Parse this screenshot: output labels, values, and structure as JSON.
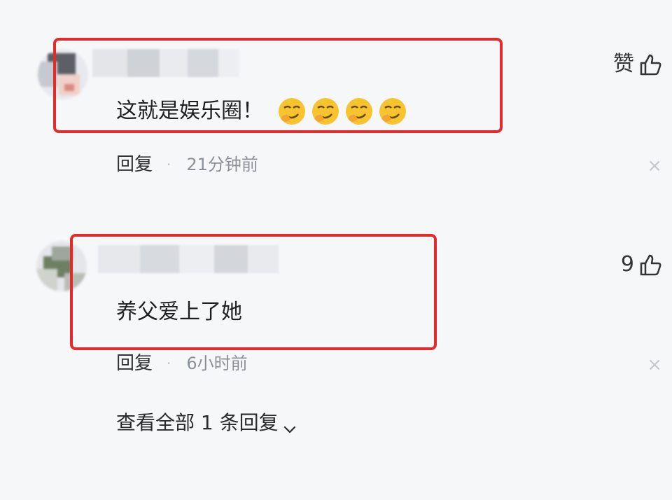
{
  "comments": [
    {
      "text": "这就是娱乐圈！",
      "emoji_count": 4,
      "emoji_icon": "smirking-face-emoji",
      "like_label": "赞",
      "reply_label": "回复",
      "separator": "·",
      "timestamp": "21分钟前",
      "close_glyph": "×"
    },
    {
      "text": "养父爱上了她",
      "like_label": "9",
      "reply_label": "回复",
      "separator": "·",
      "timestamp": "6小时前",
      "close_glyph": "×",
      "view_all_replies": "查看全部 1 条回复"
    }
  ],
  "colors": {
    "background": "#f6f7f9",
    "highlight_border": "#e42a2a",
    "meta_text": "#8a8f99",
    "emoji_yellow": "#f7c430"
  },
  "icons": {
    "like": "thumbs-up-icon",
    "close": "close-icon",
    "expand": "chevron-down-icon"
  }
}
